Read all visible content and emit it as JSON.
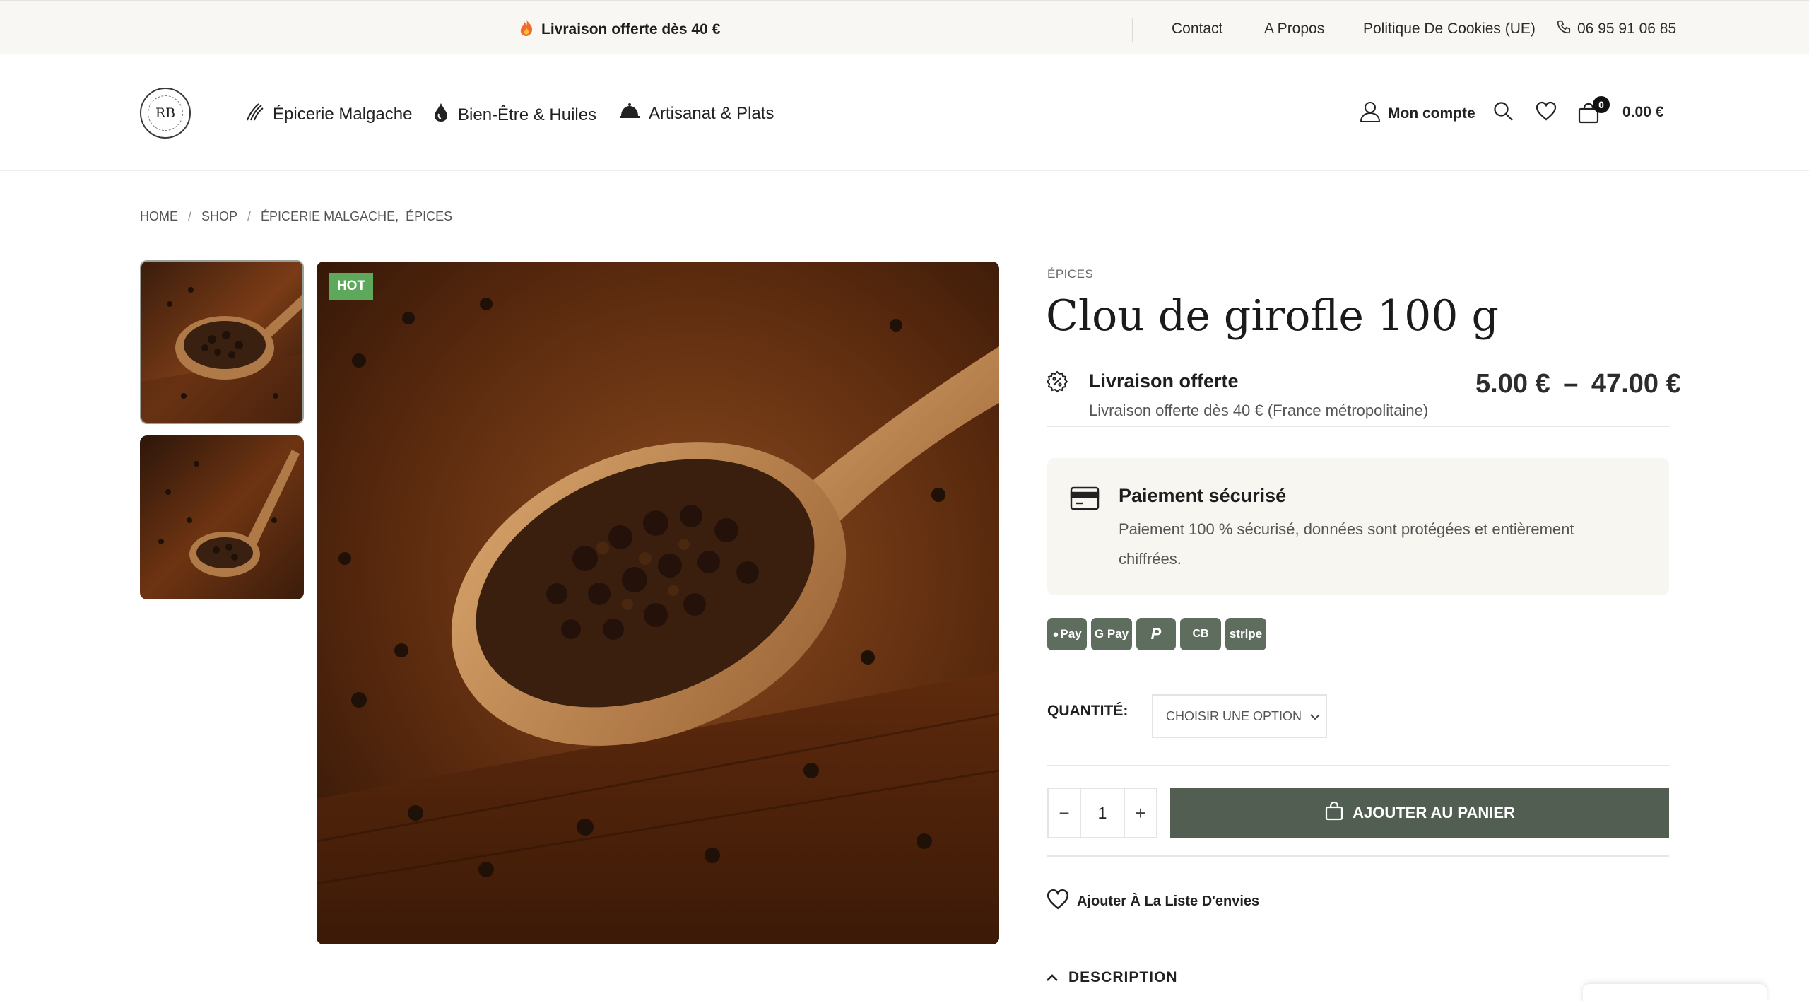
{
  "topbar": {
    "promo_text": "Livraison offerte dès 40 €",
    "links": [
      "Contact",
      "A Propos",
      "Politique De Cookies (UE)"
    ],
    "phone": "06 95 91 06 85"
  },
  "header": {
    "logo_text": "RB",
    "nav": [
      {
        "label": "Épicerie Malgache",
        "icon": "vanilla-icon"
      },
      {
        "label": "Bien-Être & Huiles",
        "icon": "drop-icon"
      },
      {
        "label": "Artisanat & Plats",
        "icon": "cloche-icon"
      }
    ],
    "account_label": "Mon compte",
    "cart_count": "0",
    "cart_total": "0.00 €"
  },
  "breadcrumb": [
    "HOME",
    "SHOP",
    "ÉPICERIE MALGACHE,",
    "ÉPICES"
  ],
  "product": {
    "badge": "HOT",
    "category": "ÉPICES",
    "title": "Clou de girofle 100 g",
    "price_min": "5.00 €",
    "price_sep": "–",
    "price_max": "47.00 €",
    "shipping_title": "Livraison offerte",
    "shipping_text": "Livraison offerte dès 40 € (France métropolitaine)",
    "secure_title": "Paiement sécurisé",
    "secure_text": "Paiement 100 % sécurisé, données sont protégées et entièrement chiffrées.",
    "payment_methods": [
      "Pay",
      "G Pay",
      "P",
      "CB",
      "stripe"
    ],
    "quantity_label": "QUANTITÉ:",
    "select_placeholder": "CHOISIR UNE OPTION",
    "quantity_value": "1",
    "minus": "−",
    "plus": "+",
    "add_to_cart": "AJOUTER AU PANIER",
    "wishlist": "Ajouter À La Liste D'envies",
    "description_tab": "DESCRIPTION"
  },
  "colors": {
    "accent_green": "#525e51",
    "hot_badge": "#5da85b",
    "topbar_bg": "#f8f7f4",
    "secure_bg": "#f7f6f0"
  }
}
